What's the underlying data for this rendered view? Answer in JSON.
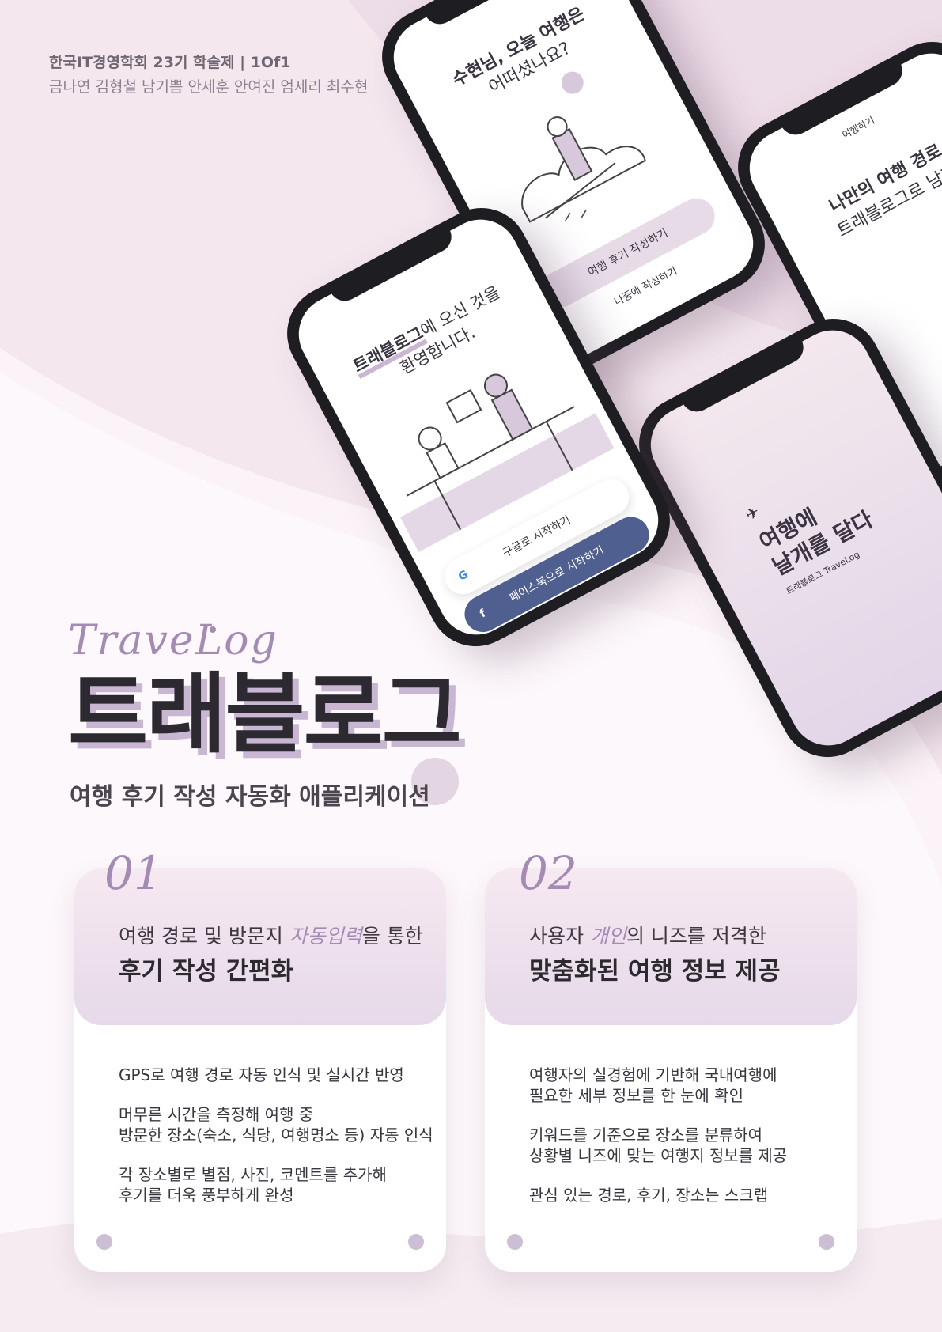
{
  "header": {
    "org": "한국IT경영학회 23기 학술제 | 1Of1",
    "members": "금나연 김형철 남기쁨 안세훈 안여진 엄세리 최수현"
  },
  "phones": {
    "welcome": {
      "headline_bold": "트래블로그",
      "headline_rest": "에 오신 것을",
      "headline_line2": "환영합니다.",
      "google_button": "구글로 시작하기",
      "facebook_button": "페이스북으로 시작하기"
    },
    "question": {
      "line1": "수현님, 오늘 여행은",
      "line2": "어떠셨나요?",
      "primary_button": "여행 후기 작성하기",
      "secondary_link": "나중에 작성하기"
    },
    "route": {
      "top_label": "여행하기",
      "line1": "나만의 여행 경로",
      "line2": "트래블로그로 남기"
    },
    "splash": {
      "line1": "여행에",
      "line2": "날개를 달다",
      "brand": "트래블로그 TraveLog"
    }
  },
  "brand": {
    "script_name": "TraveLog",
    "title": "트래블로그",
    "subtitle": "여행 후기 작성 자동화 애플리케이션"
  },
  "features": [
    {
      "number": "01",
      "line1_pre": "여행 경로 및 방문지 ",
      "line1_accent": "자동입력",
      "line1_post": "을 통한",
      "line2": "후기 작성 간편화",
      "bullets": [
        "GPS로 여행 경로 자동 인식 및 실시간 반영",
        "머무른 시간을 측정해 여행 중",
        "방문한 장소(숙소, 식당, 여행명소 등) 자동 인식",
        "각 장소별로 별점, 사진, 코멘트를 추가해",
        "후기를 더욱 풍부하게 완성"
      ]
    },
    {
      "number": "02",
      "line1_pre": "사용자 ",
      "line1_accent": "개인",
      "line1_post": "의 니즈를 저격한",
      "line2": "맞춤화된 여행 정보 제공",
      "bullets": [
        "여행자의 실경험에 기반해 국내여행에",
        "필요한 세부 정보를 한 눈에 확인",
        "키워드를 기준으로 장소를 분류하여",
        "상황별 니즈에 맞는 여행지 정보를 제공",
        "관심 있는 경로, 후기, 장소는 스크랩"
      ]
    }
  ],
  "colors": {
    "accent": "#a48bb5",
    "facebook": "#4f5f8f",
    "dark": "#2c2a30",
    "pink_bg": "#f3e6ec"
  }
}
